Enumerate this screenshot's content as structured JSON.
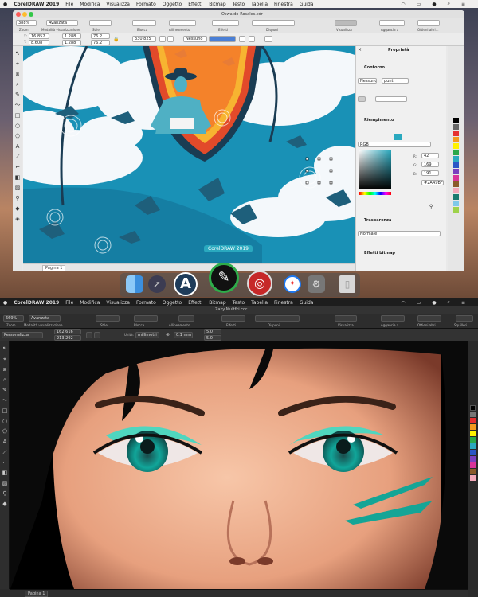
{
  "top": {
    "menu": [
      "CorelDRAW 2019",
      "File",
      "Modifica",
      "Visualizza",
      "Formato",
      "Oggetto",
      "Effetti",
      "Bitmap",
      "Testo",
      "Tabella",
      "Finestra",
      "Guida"
    ],
    "doc_title": "Oswaldo-Rosales.cdr",
    "clock": "",
    "zoom": "388%",
    "view_mode": "Avanzata",
    "ribbon_labels": [
      "Zoom",
      "Modalità visualizzazione",
      "Stile",
      "Blocca",
      "Allineamento",
      "Effetti",
      "Disponi",
      "Visualizza",
      "Aggancia a",
      "Ottieni altri..."
    ],
    "x_value": "16.852",
    "y_value": "8.608",
    "w_value": "1.288",
    "h_value": "1.288",
    "sx_value": "76.2",
    "sy_value": "76.2",
    "angle_value": "330.825",
    "outline_none": "Nessuno",
    "page_tab": "Pagina 1",
    "dock_tooltip": "CorelDRAW 2019",
    "panel": {
      "title": "Proprietà",
      "outline_header": "Contorno",
      "outline_width": "Nessuno",
      "outline_units": "punti",
      "fill_header": "Riempimento",
      "color_model": "RGB",
      "r_label": "R:",
      "r_value": "42",
      "g_label": "G:",
      "g_value": "169",
      "b_label": "B:",
      "b_value": "191",
      "hex_value": "#2AA9BF",
      "transparency_header": "Trasparenza",
      "transparency_mode": "Normale",
      "bitmap_effects_header": "Effetti bitmap"
    },
    "colors": {
      "accent_fill": "#2aa9bf",
      "sky": "#1a8fb5",
      "orange": "#f4822a",
      "shield": "#e24a2a"
    }
  },
  "bottom": {
    "menu": [
      "CorelDRAW 2019",
      "File",
      "Modifica",
      "Visualizza",
      "Formato",
      "Oggetto",
      "Effetti",
      "Bitmap",
      "Testo",
      "Tabella",
      "Finestra",
      "Guida"
    ],
    "doc_title": "Zaky Multfki.cdr",
    "zoom": "669%",
    "view_mode": "Avanzata",
    "ribbon_labels": [
      "Zoom",
      "Modalità visualizzazione",
      "Stile",
      "Blocca",
      "Effetti",
      "Allineamento",
      "Disponi",
      "Visualizza",
      "Aggancia a",
      "Ottieni altri...",
      "Squilleri"
    ],
    "preset": "Personalizza",
    "x_value": "162.616",
    "y_value": "213.292",
    "units_label": "Unità:",
    "units_value": "millimetri",
    "nudge_value": "0.1 mm",
    "dup_x": "5.0",
    "dup_y": "5.0",
    "page_tab": "Pagina 1"
  }
}
